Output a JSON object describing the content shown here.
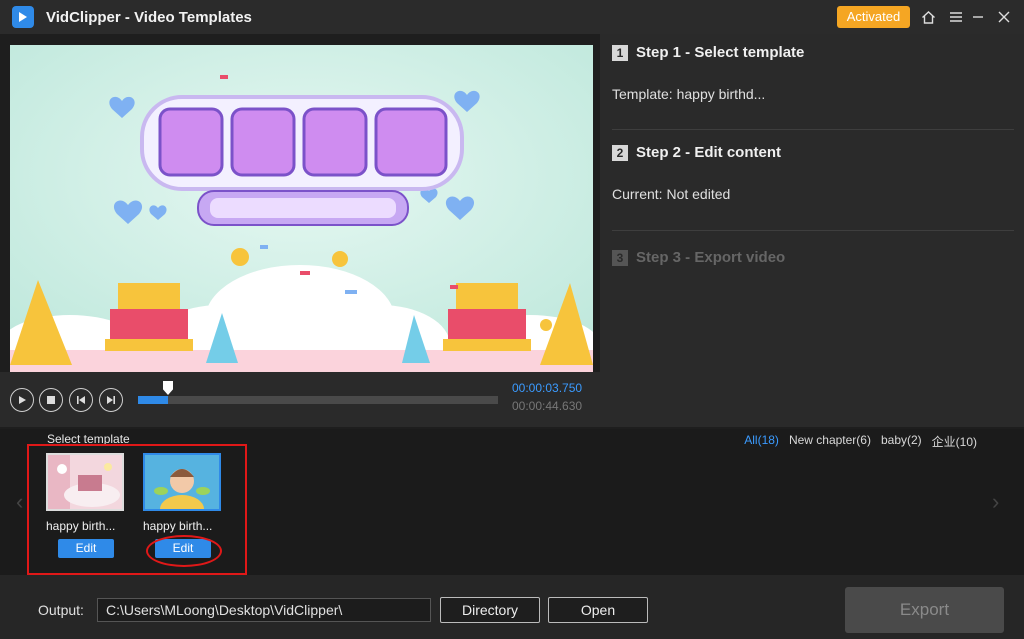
{
  "app": {
    "title": "VidClipper - Video Templates",
    "activated_label": "Activated"
  },
  "player": {
    "current_time": "00:00:03.750",
    "total_time": "00:00:44.630",
    "progress": 0.084
  },
  "steps": {
    "step1": {
      "num": "1",
      "title": "Step 1 - Select template",
      "line": "Template:  happy birthd..."
    },
    "step2": {
      "num": "2",
      "title": "Step 2 - Edit content",
      "line": "Current:  Not edited"
    },
    "step3": {
      "num": "3",
      "title": "Step 3 - Export video"
    }
  },
  "templates": {
    "label": "Select template",
    "filters": [
      "All(18)",
      "New chapter(6)",
      "baby(2)",
      "企业(10)"
    ],
    "items": [
      {
        "name": "happy birth...",
        "edit_label": "Edit"
      },
      {
        "name": "happy birth...",
        "edit_label": "Edit"
      }
    ]
  },
  "output": {
    "label": "Output:",
    "path": "C:\\Users\\MLoong\\Desktop\\VidClipper\\",
    "directory_label": "Directory",
    "open_label": "Open",
    "export_label": "Export"
  },
  "colors": {
    "accent": "#2f8ae8",
    "activated": "#f5a623",
    "annotation": "#e01818"
  }
}
